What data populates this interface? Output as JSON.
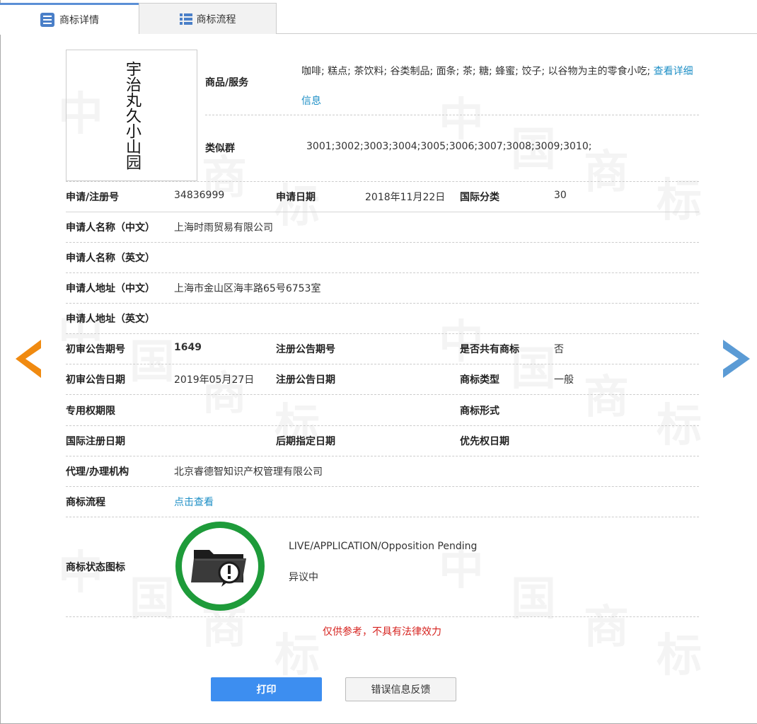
{
  "tabs": [
    {
      "label": "商标详情",
      "active": true
    },
    {
      "label": "商标流程",
      "active": false
    }
  ],
  "trademark": {
    "mark_text": "宇治丸久小山园",
    "goods_label": "商品/服务",
    "goods_value": "咖啡; 糕点; 茶饮料; 谷类制品; 面条; 茶; 糖; 蜂蜜; 饺子; 以谷物为主的零食小吃;",
    "goods_link": "查看详细信息",
    "similar_label": "类似群",
    "similar_value": "3001;3002;3003;3004;3005;3006;3007;3008;3009;3010;"
  },
  "fields": {
    "reg_no_label": "申请/注册号",
    "reg_no": "34836999",
    "app_date_label": "申请日期",
    "app_date": "2018年11月22日",
    "intl_class_label": "国际分类",
    "intl_class": "30",
    "applicant_cn_label": "申请人名称（中文）",
    "applicant_cn": "上海时雨贸易有限公司",
    "applicant_en_label": "申请人名称（英文）",
    "applicant_en": "",
    "address_cn_label": "申请人地址（中文）",
    "address_cn": "上海市金山区海丰路65号6753室",
    "address_en_label": "申请人地址（英文）",
    "address_en": "",
    "prelim_no_label": "初审公告期号",
    "prelim_no": "1649",
    "reg_pub_no_label": "注册公告期号",
    "reg_pub_no": "",
    "shared_label": "是否共有商标",
    "shared": "否",
    "prelim_date_label": "初审公告日期",
    "prelim_date": "2019年05月27日",
    "reg_pub_date_label": "注册公告日期",
    "reg_pub_date": "",
    "mark_type_label": "商标类型",
    "mark_type": "一般",
    "exclusive_label": "专用权期限",
    "exclusive": "",
    "mark_form_label": "商标形式",
    "mark_form": "",
    "intl_reg_date_label": "国际注册日期",
    "intl_reg_date": "",
    "later_date_label": "后期指定日期",
    "later_date": "",
    "priority_label": "优先权日期",
    "priority": "",
    "agent_label": "代理/办理机构",
    "agent": "北京睿德智知识产权管理有限公司",
    "flow_label": "商标流程",
    "flow_link": "点击查看",
    "status_label": "商标状态图标",
    "status_en": "LIVE/APPLICATION/Opposition Pending",
    "status_cn": "异议中"
  },
  "disclaimer": "仅供参考，不具有法律效力",
  "buttons": {
    "print": "打印",
    "feedback": "错误信息反馈"
  },
  "watermark": [
    "中",
    "国",
    "商",
    "标"
  ],
  "colors": {
    "accent_blue": "#3d8ef0",
    "link": "#1e8fc6",
    "status_green": "#1e9b3a",
    "prev_arrow": "#f08a10",
    "next_arrow": "#5b9bd5",
    "disclaimer_red": "#d6231f"
  }
}
